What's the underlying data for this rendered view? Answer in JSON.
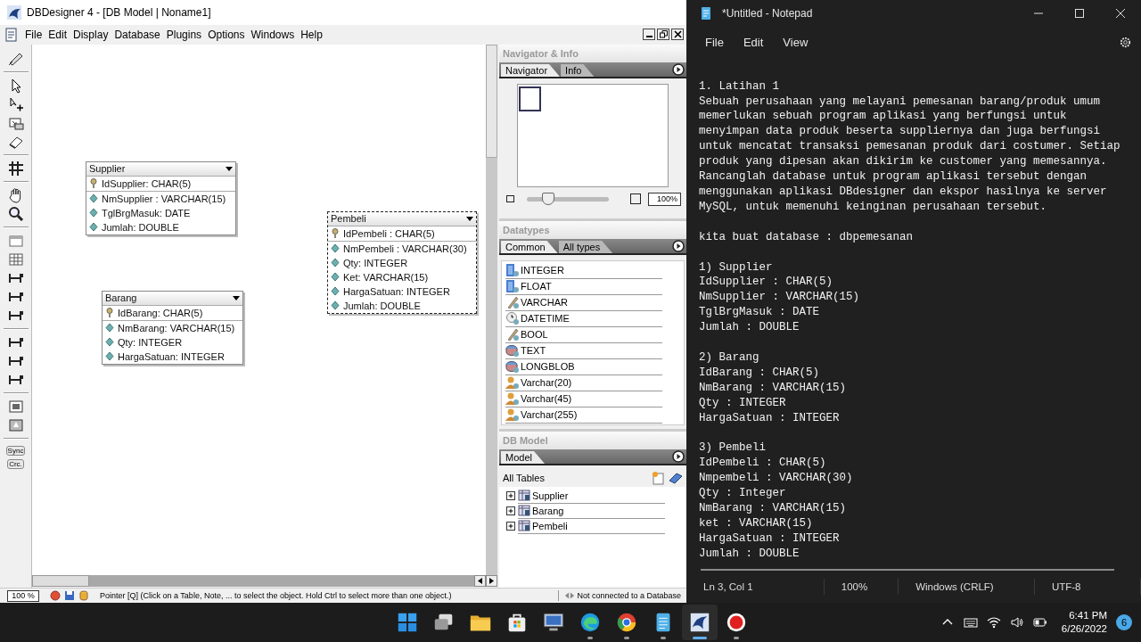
{
  "dbdesigner": {
    "title": "DBDesigner 4 - [DB Model | Noname1]",
    "menu": [
      "File",
      "Edit",
      "Display",
      "Database",
      "Plugins",
      "Options",
      "Windows",
      "Help"
    ],
    "toolbar_buttons": [
      "Sync",
      "Crc."
    ],
    "tables": [
      {
        "name": "Supplier",
        "selected": false,
        "columns": [
          {
            "text": "IdSupplier: CHAR(5)",
            "kind": "key"
          },
          {
            "text": "NmSupplier : VARCHAR(15)",
            "kind": "field"
          },
          {
            "text": "TglBrgMasuk: DATE",
            "kind": "field"
          },
          {
            "text": "Jumlah: DOUBLE",
            "kind": "field"
          }
        ]
      },
      {
        "name": "Barang",
        "selected": false,
        "columns": [
          {
            "text": "IdBarang: CHAR(5)",
            "kind": "key"
          },
          {
            "text": "NmBarang: VARCHAR(15)",
            "kind": "field"
          },
          {
            "text": "Qty: INTEGER",
            "kind": "field"
          },
          {
            "text": "HargaSatuan: INTEGER",
            "kind": "field"
          }
        ]
      },
      {
        "name": "Pembeli",
        "selected": true,
        "columns": [
          {
            "text": "IdPembeli : CHAR(5)",
            "kind": "key"
          },
          {
            "text": "NmPembeli : VARCHAR(30)",
            "kind": "field"
          },
          {
            "text": "Qty: INTEGER",
            "kind": "field"
          },
          {
            "text": "Ket: VARCHAR(15)",
            "kind": "field"
          },
          {
            "text": "HargaSatuan: INTEGER",
            "kind": "field"
          },
          {
            "text": "Jumlah: DOUBLE",
            "kind": "field"
          }
        ]
      }
    ],
    "navigator": {
      "title": "Navigator & Info",
      "tabs": [
        {
          "label": "Navigator",
          "selected": true
        },
        {
          "label": "Info",
          "selected": false
        }
      ],
      "zoom": {
        "level": 0.27,
        "value": "100%"
      }
    },
    "datatypes": {
      "title": "Datatypes",
      "tabs": [
        {
          "label": "Common",
          "selected": true
        },
        {
          "label": "All types",
          "selected": false
        }
      ],
      "items": [
        {
          "label": "INTEGER",
          "kind": "numeric"
        },
        {
          "label": "FLOAT",
          "kind": "numeric"
        },
        {
          "label": "VARCHAR",
          "kind": "string"
        },
        {
          "label": "DATETIME",
          "kind": "date"
        },
        {
          "label": "BOOL",
          "kind": "string"
        },
        {
          "label": "TEXT",
          "kind": "blob"
        },
        {
          "label": "LONGBLOB",
          "kind": "blob"
        },
        {
          "label": "Varchar(20)",
          "kind": "user"
        },
        {
          "label": "Varchar(45)",
          "kind": "user"
        },
        {
          "label": "Varchar(255)",
          "kind": "user"
        }
      ]
    },
    "db_model": {
      "title": "DB Model",
      "tabs": [
        {
          "label": "Model",
          "selected": true
        }
      ],
      "heading": "All Tables",
      "tree": [
        {
          "label": "Supplier",
          "expanded": false
        },
        {
          "label": "Barang",
          "expanded": false
        },
        {
          "label": "Pembeli",
          "expanded": false
        }
      ]
    },
    "status_bar": {
      "zoom": "100 %",
      "message": "Pointer [Q] (Click on a Table, Note, ... to select the object. Hold Ctrl to select more than one object.)",
      "connection": "Not connected to a Database"
    }
  },
  "notepad": {
    "title": "*Untitled - Notepad",
    "menu": [
      "File",
      "Edit",
      "View"
    ],
    "paragraphs": [
      [
        "1. Latihan 1",
        "Sebuah perusahaan yang melayani pemesanan barang/produk umum",
        "memerlukan sebuah program aplikasi yang berfungsi untuk",
        "menyimpan data produk beserta suppliernya dan juga berfungsi",
        "untuk mencatat transaksi pemesanan produk dari costumer. Setiap",
        "produk yang dipesan akan dikirim ke customer yang memesannya.",
        "Rancanglah database untuk program aplikasi tersebut dengan",
        "menggunakan aplikasi DBdesigner dan ekspor hasilnya ke server",
        "MySQL, untuk memenuhi keinginan perusahaan tersebut."
      ],
      [
        "kita buat database : dbpemesanan"
      ],
      [
        "1) Supplier",
        "IdSupplier : CHAR(5)",
        "NmSupplier : VARCHAR(15)",
        "TglBrgMasuk : DATE",
        "Jumlah : DOUBLE"
      ],
      [
        "2) Barang",
        "IdBarang : CHAR(5)",
        "NmBarang : VARCHAR(15)",
        "Qty : INTEGER",
        "HargaSatuan : INTEGER"
      ],
      [
        "3) Pembeli",
        "IdPembeli : CHAR(5)",
        "Nmpembeli : VARCHAR(30)",
        "Qty : Integer",
        "NmBarang : VARCHAR(15)",
        "ket : VARCHAR(15)",
        "HargaSatuan : INTEGER",
        "Jumlah : DOUBLE"
      ]
    ],
    "status_bar": [
      "Ln 3, Col 1",
      "100%",
      "Windows (CRLF)",
      "UTF-8"
    ]
  },
  "taskbar": {
    "apps": [
      {
        "kind": "start",
        "running": false,
        "active": false
      },
      {
        "kind": "taskview",
        "running": false,
        "active": false
      },
      {
        "kind": "folder",
        "running": false,
        "active": false
      },
      {
        "kind": "store",
        "running": false,
        "active": false
      },
      {
        "kind": "monitor",
        "running": false,
        "active": false
      },
      {
        "kind": "edge",
        "running": true,
        "active": false
      },
      {
        "kind": "chrome",
        "running": true,
        "active": false
      },
      {
        "kind": "notepad",
        "running": true,
        "active": false
      },
      {
        "kind": "dbdesigner",
        "running": true,
        "active": true
      },
      {
        "kind": "record",
        "running": true,
        "active": false
      }
    ],
    "time": "6:41 PM",
    "date": "6/26/2022",
    "notifications": "6"
  }
}
